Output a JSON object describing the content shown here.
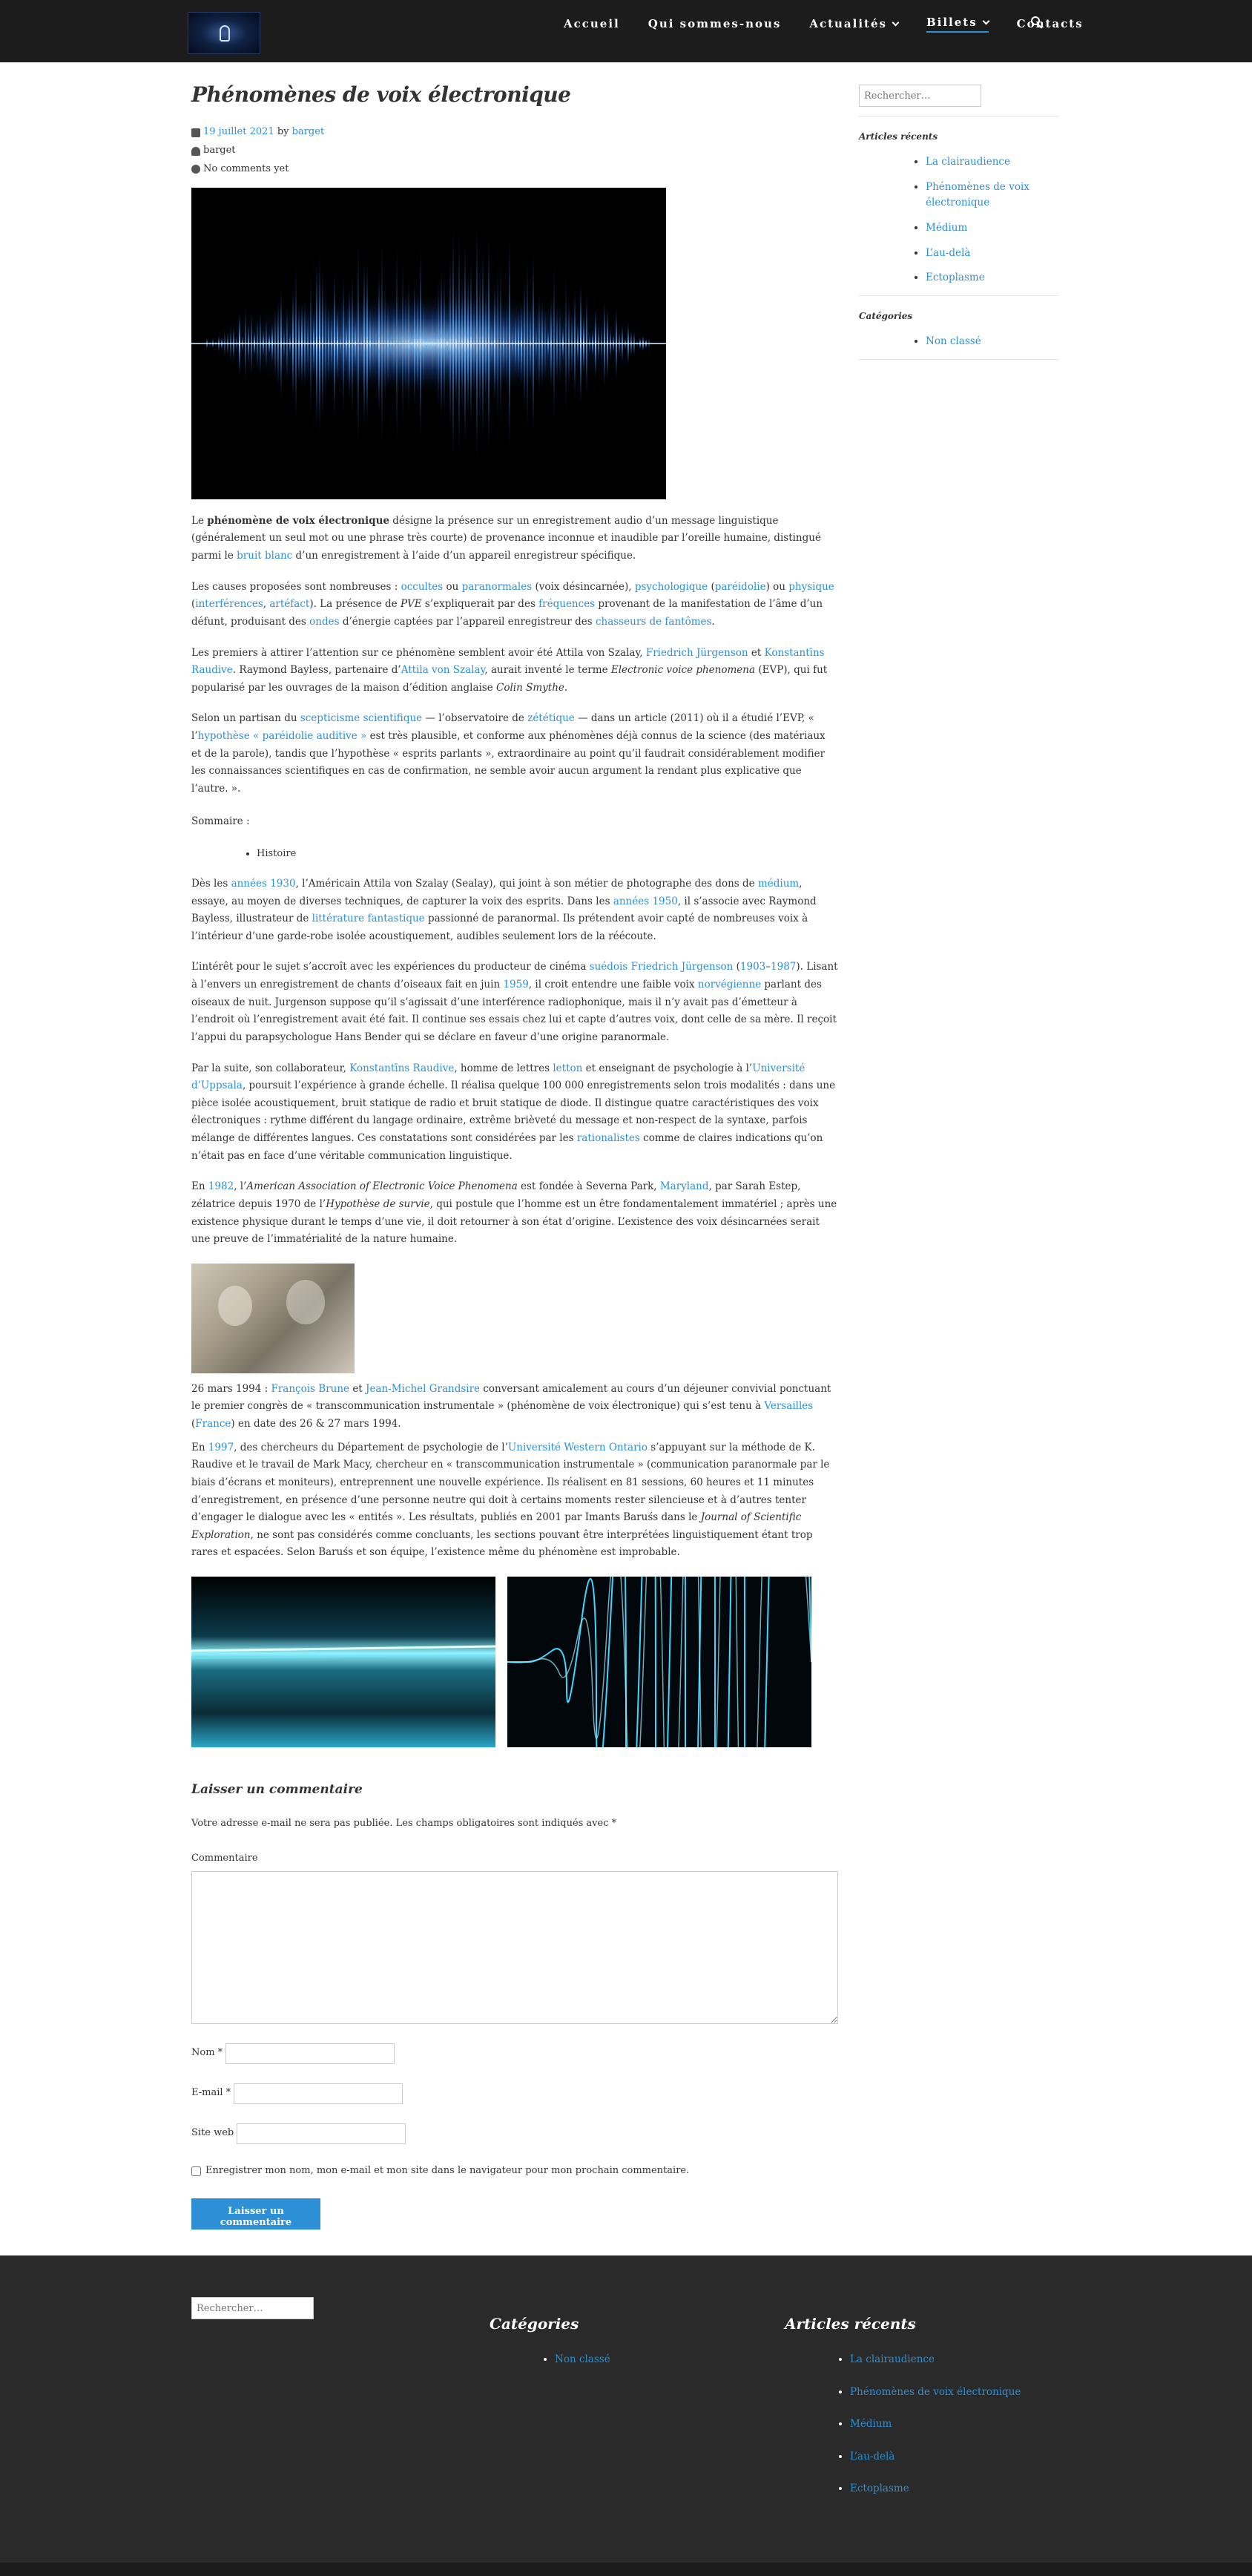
{
  "nav": {
    "items": [
      "Accueil",
      "Qui sommes-nous",
      "Actualités",
      "Billets",
      "Contacts"
    ]
  },
  "post": {
    "title": "Phénomènes de voix électronique",
    "date": "19 juillet 2021",
    "by": "by",
    "author_link": "barget",
    "author_line": "barget",
    "comments": "No comments yet",
    "p1": {
      "a": "Le ",
      "b": "phénomène de voix électronique",
      "c": " désigne la présence sur un enregistrement audio d’un message linguistique (généralement un seul mot ou une phrase très courte) de provenance inconnue et inaudible par l’oreille humaine, distingué parmi le ",
      "d": "bruit blanc",
      "e": " d’un enregistrement à l’aide d’un appareil enregistreur spécifique."
    },
    "p2": {
      "a": "Les causes proposées sont nombreuses : ",
      "b": "occultes",
      "c": " ou ",
      "d": "paranormales",
      "e": " (voix désincarnée), ",
      "f": "psychologique",
      "g": " (",
      "h": "paréidolie",
      "i": ") ou ",
      "j": "physique",
      "k": " (",
      "l": "interférences",
      "m": ", ",
      "n": "artéfact",
      "o": "). La présence de ",
      "p": "PVE",
      "q": " s’expliquerait par des ",
      "r": "fréquences",
      "s": " provenant de la manifestation de l’âme d’un défunt, produisant des ",
      "t": "ondes",
      "u": " d’énergie captées par l’appareil enregistreur des ",
      "v": "chasseurs de fantômes",
      "w": "."
    },
    "p3": {
      "a": "Les premiers à attirer l’attention sur ce phénomène semblent avoir été Attila von Szalay, ",
      "b": "Friedrich Jürgenson",
      "c": " et ",
      "d": "Konstantīns Raudive",
      "e": ". Raymond Bayless, partenaire d’",
      "f": "Attila von Szalay",
      "g": ", aurait inventé le terme ",
      "h": "Electronic voice phenomena",
      "i": " (EVP), qui fut popularisé par les ouvrages de la maison d’édition anglaise ",
      "j": "Colin Smythe",
      "k": "."
    },
    "p4": {
      "a": "Selon un partisan du ",
      "b": "scepticisme scientifique",
      "c": " — l’observatoire de ",
      "d": "zététique",
      "e": " — dans un article (2011) où il a étudié l’EVP, « l’",
      "f": "hypothèse « paréidolie auditive »",
      "g": " est très plausible, et conforme aux phénomènes déjà connus de la science (des matériaux et de la parole), tandis que l’hypothèse « esprits parlants », extraordinaire au point qu’il faudrait considérablement modifier les connaissances scientifiques en cas de confirmation, ne semble avoir aucun argument la rendant plus explicative que l’autre. »."
    },
    "sommaire": "Sommaire :",
    "toc": [
      "Histoire"
    ],
    "p5": {
      "a": "Dès les ",
      "b": "années 1930",
      "c": ", l’Américain Attila von Szalay (Sealay), qui joint à son métier de photographe des dons de ",
      "d": "médium",
      "e": ", essaye, au moyen de diverses techniques, de capturer la voix des esprits. Dans les ",
      "f": "années 1950",
      "g": ", il s’associe avec Raymond Bayless, illustrateur de ",
      "h": "littérature fantastique",
      "i": " passionné de paranormal. Ils prétendent avoir capté de nombreuses voix à l’intérieur d’une garde-robe isolée acoustiquement, audibles seulement lors de la réécoute."
    },
    "p6": {
      "a": "L’intérêt pour le sujet s’accroît avec les expériences du producteur de cinéma ",
      "b": "suédois",
      "c": " ",
      "d": "Friedrich Jürgenson",
      "e": " (",
      "f": "1903",
      "g": "–",
      "h": "1987",
      "i": "). Lisant à l’envers un enregistrement de chants d’oiseaux fait en juin ",
      "j": "1959",
      "k": ", il croit entendre une faible voix ",
      "l": "norvégienne",
      "m": " parlant des oiseaux de nuit. Jurgenson suppose qu’il s’agissait d’une interférence radiophonique, mais il n’y avait pas d’émetteur à l’endroit où l’enregistrement avait été fait. Il continue ses essais chez lui et capte d’autres voix, dont celle de sa mère. Il reçoit l’appui du parapsychologue Hans Bender qui se déclare en faveur d’une origine paranormale."
    },
    "p7": {
      "a": "Par la suite, son collaborateur, ",
      "b": "Konstantīns Raudive",
      "c": ", homme de lettres ",
      "d": "letton",
      "e": " et enseignant de psychologie à l’",
      "f": "Université d’Uppsala",
      "g": ", poursuit l’expérience à grande échelle. Il réalisa quelque 100 000 enregistrements selon trois modalités : dans une pièce isolée acoustiquement, bruit statique de radio et bruit statique de diode. Il distingue quatre caractéristiques des voix électroniques : rythme différent du langage ordinaire, extrême brièveté du message et non-respect de la syntaxe, parfois mélange de différentes langues. Ces constatations sont considérées par les ",
      "h": "rationalistes",
      "i": " comme de claires indications qu’on n’était pas en face d’une véritable communication linguistique."
    },
    "p8": {
      "a": "En ",
      "b": "1982",
      "c": ", l’",
      "d": "American Association of Electronic Voice Phenomena",
      "e": " est fondée à Severna Park, ",
      "f": "Maryland",
      "g": ", par Sarah Estep, zélatrice depuis 1970 de l’",
      "h": "Hypothèse de survie",
      "i": ", qui postule que l’homme est un être fondamentalement immatériel ; après une existence physique durant le temps d’une vie, il doit retourner à son état d’origine. L’existence des voix désincarnées serait une preuve de l’immatérialité de la nature humaine."
    },
    "caption": {
      "a": "26 mars 1994 : ",
      "b": "François Brune",
      "c": " et ",
      "d": "Jean-Michel Grandsire",
      "e": " conversant amicalement au cours d’un déjeuner convivial ponctuant le premier congrès de « transcommunication instrumentale » (phénomène de voix électronique) qui s’est tenu à ",
      "f": "Versailles",
      "g": " (",
      "h": "France",
      "i": ") en date des 26 & 27 mars 1994."
    },
    "p9": {
      "a": "En ",
      "b": "1997",
      "c": ", des chercheurs du Département de psychologie de l’",
      "d": "Université Western Ontario",
      "e": " s’appuyant sur la méthode de K. Raudive et le travail de Mark Macy, chercheur en « transcommunication instrumentale » (communication paranormale par le biais d’écrans et moniteurs), entreprennent une nouvelle expérience. Ils réalisent en 81 sessions, 60 heures et 11 minutes d’enregistrement, en présence d’une personne neutre qui doit à certains moments rester silencieuse et à d’autres tenter d’engager le dialogue avec les « entités ». Les résultats, publiés en 2001 par Imants Baruśs dans le ",
      "f": "Journal of Scientific Exploration",
      "g": ", ne sont pas considérés comme concluants, les sections pouvant être interprétées linguistiquement étant trop rares et espacées. Selon Baruśs et son équipe, l’existence même du phénomène est improbable."
    }
  },
  "comment_form": {
    "title": "Laisser un commentaire",
    "notice": "Votre adresse e-mail ne sera pas publiée. Les champs obligatoires sont indiqués avec *",
    "comment_label": "Commentaire",
    "name_label": "Nom *",
    "email_label": "E-mail *",
    "site_label": "Site web",
    "save_label": "Enregistrer mon nom, mon e-mail et mon site dans le navigateur pour mon prochain commentaire.",
    "submit": "Laisser un commentaire"
  },
  "sidebar": {
    "search_placeholder": "Rechercher…",
    "recent_title": "Articles récents",
    "recent": [
      "La clairaudience",
      "Phénomènes de voix électronique",
      "Médium",
      "L’au-delà",
      "Ectoplasme"
    ],
    "cat_title": "Catégories",
    "categories": [
      "Non classé"
    ]
  },
  "footer": {
    "search_placeholder": "Rechercher…",
    "cat_title": "Catégories",
    "categories": [
      "Non classé"
    ],
    "recent_title": "Articles récents",
    "recent": [
      "La clairaudience",
      "Phénomènes de voix électronique",
      "Médium",
      "L’au-delà",
      "Ectoplasme"
    ]
  },
  "colors": {
    "accent": "#2d8fd5",
    "topbar": "#1c1c1c",
    "footer": "#2a2a2a"
  }
}
